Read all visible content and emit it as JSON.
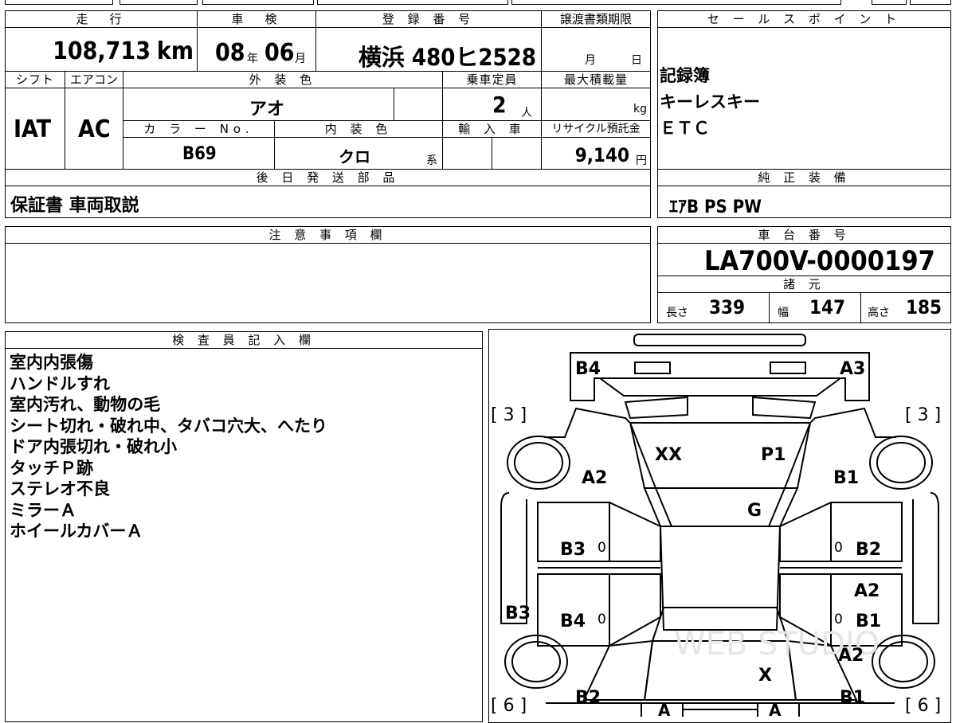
{
  "top_table": {
    "mileage_header": "走　行",
    "mileage_value": "108,713",
    "mileage_unit": "km",
    "inspection_header": "車　検",
    "inspection_year": "08",
    "inspection_year_unit": "年",
    "inspection_month": "06",
    "inspection_month_unit": "月",
    "registration_header": "登 録 番 号",
    "registration_value": "横浜 480ヒ2528",
    "transfer_header": "譲渡書類期限",
    "transfer_month_unit": "月",
    "transfer_day_unit": "日",
    "shift_header": "シフト",
    "shift_value": "IAT",
    "ac_header": "エアコン",
    "ac_value": "AC",
    "exterior_header": "外 装 色",
    "exterior_value": "アオ",
    "color_no_header": "カ ラ ー No.",
    "color_no_value": "B69",
    "interior_header": "内 装 色",
    "interior_value": "クロ",
    "interior_suffix": "系",
    "capacity_header": "乗車定員",
    "capacity_value": "2",
    "capacity_unit": "人",
    "import_header": "輸 入 車",
    "max_load_header": "最大積載量",
    "max_load_unit": "kg",
    "recycle_header": "リサイクル預託金",
    "recycle_value": "9,140",
    "recycle_unit": "円",
    "later_parts_header": "後 日 発 送 部 品",
    "later_parts_value": "保証書 車両取説"
  },
  "sales_points": {
    "header": "セ ー ル ス ポ イ ン ト",
    "items": [
      "記録簿",
      "キーレスキー",
      "ＥＴＣ"
    ]
  },
  "genuine_equipment": {
    "header": "純 正 装 備",
    "value": "ｴｱB PS PW"
  },
  "caution": {
    "header": "注 意 事 項 欄"
  },
  "chassis": {
    "header": "車 台 番 号",
    "value": "LA700V-0000197",
    "specs_header": "諸 元",
    "length_label": "長さ",
    "length_value": "339",
    "width_label": "幅",
    "width_value": "147",
    "height_label": "高さ",
    "height_value": "185"
  },
  "inspector": {
    "header": "検 査 員 記 入 欄",
    "notes": [
      "室内内張傷",
      "ハンドルすれ",
      "室内汚れ、動物の毛",
      "シート切れ・破れ中、タバコ穴大、へたり",
      "ドア内張切れ・破れ小",
      "タッチＰ跡",
      "ステレオ不良",
      "ミラーＡ",
      "ホイールカバーＡ"
    ]
  },
  "diagram": {
    "marks": {
      "b4_top": "B4",
      "a3_top": "A3",
      "xx": "XX",
      "p1": "P1",
      "a2_left": "A2",
      "b1_right": "B1",
      "g": "G",
      "b3_left_door": "B3",
      "b2_right_door": "B2",
      "a2_right": "A2",
      "b3_left_side": "B3",
      "b4_left_door": "B4",
      "b1_right_door": "B1",
      "a2_right_lower": "A2",
      "x": "X",
      "b2_bottom_left": "B2",
      "b1_bottom_right": "B1",
      "a_bottom_left": "A",
      "a_bottom_right": "A"
    },
    "tread_front_left": "3",
    "tread_front_right": "3",
    "tread_rear_left": "6",
    "tread_rear_right": "6",
    "door_zero": "0",
    "watermark": "WEB STUDIO"
  }
}
